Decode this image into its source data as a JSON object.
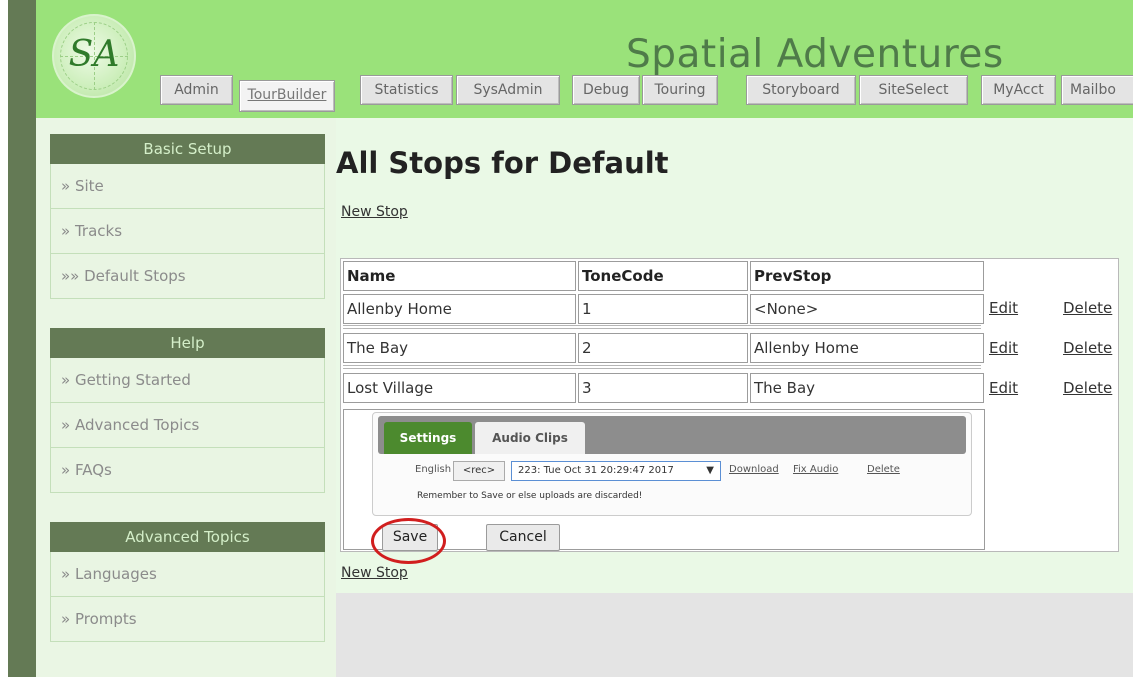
{
  "header": {
    "logo_text": "SA",
    "site_title": "Spatial Adventures",
    "tabs": [
      "Admin",
      "TourBuilder",
      "Statistics",
      "SysAdmin",
      "Debug",
      "Touring",
      "Storyboard",
      "SiteSelect",
      "MyAcct",
      "Mailbo"
    ],
    "active_tab": "TourBuilder"
  },
  "sidebar": {
    "sections": [
      {
        "title": "Basic Setup",
        "items": [
          "» Site",
          "» Tracks",
          "»» Default Stops"
        ]
      },
      {
        "title": "Help",
        "items": [
          "» Getting Started",
          "» Advanced Topics",
          "» FAQs"
        ]
      },
      {
        "title": "Advanced Topics",
        "items": [
          "» Languages",
          "» Prompts"
        ]
      }
    ]
  },
  "main": {
    "title": "All Stops for Default",
    "new_stop_label": "New Stop",
    "table": {
      "headers": [
        "Name",
        "ToneCode",
        "PrevStop"
      ],
      "rows": [
        {
          "name": "Allenby Home",
          "tone": "1",
          "prev": "<None>"
        },
        {
          "name": "The Bay",
          "tone": "2",
          "prev": "Allenby Home"
        },
        {
          "name": "Lost Village",
          "tone": "3",
          "prev": "The Bay"
        }
      ],
      "edit_label": "Edit",
      "delete_label": "Delete"
    },
    "editor": {
      "tab_settings": "Settings",
      "tab_audio": "Audio Clips",
      "language": "English",
      "rec_label": "<rec>",
      "clip_selected": "223: Tue Oct 31 20:29:47 2017",
      "select_arrow": "▼",
      "download_label": "Download",
      "fix_audio_label": "Fix Audio",
      "delete_label": "Delete",
      "reminder": "Remember to Save or else uploads are discarded!",
      "save_label": "Save",
      "cancel_label": "Cancel"
    }
  },
  "colors": {
    "header_bg": "#9ae27a",
    "sidebar_header": "#647a55",
    "accent_green": "#4c8a2e",
    "highlight_circle": "#d11e1e"
  }
}
